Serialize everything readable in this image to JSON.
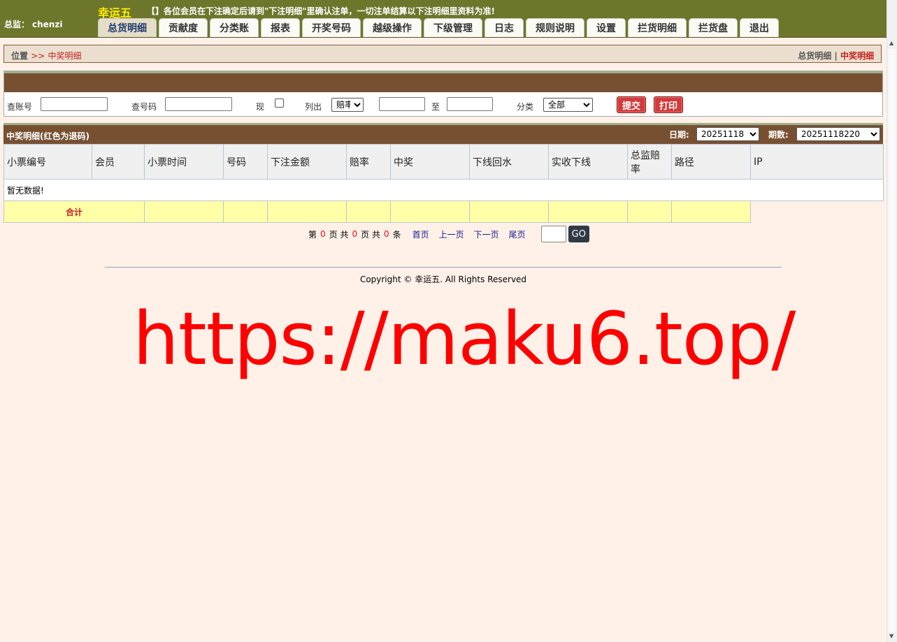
{
  "header": {
    "user_label": "总监：",
    "user_name": "chenzi",
    "brand": "幸运五",
    "notice": "【】各位会员在下注确定后请到\"下注明细\"里确认注单，一切注单结算以下注明细里资料为准!",
    "tabs": [
      {
        "label": "总货明细",
        "active": true
      },
      {
        "label": "贡献度"
      },
      {
        "label": "分类账"
      },
      {
        "label": "报表"
      },
      {
        "label": "开奖号码"
      },
      {
        "label": "越级操作"
      },
      {
        "label": "下级管理"
      },
      {
        "label": "日志"
      },
      {
        "label": "规则说明"
      },
      {
        "label": "设置"
      },
      {
        "label": "拦货明细"
      },
      {
        "label": "拦货盘"
      },
      {
        "label": "退出"
      }
    ]
  },
  "breadcrumb": {
    "prefix": "位置",
    "sep": ">>",
    "current": "中奖明细",
    "right_link": "总货明细",
    "right_sep": "|",
    "right_current": "中奖明细"
  },
  "filter": {
    "account_label": "查账号",
    "account_value": "",
    "number_label": "查号码",
    "number_value": "",
    "current_label": "现",
    "list_label": "列出",
    "list_selected": "赔率",
    "range_from": "",
    "range_to_label": "至",
    "range_to": "",
    "category_label": "分类",
    "category_selected": "全部",
    "submit_label": "提交",
    "print_label": "打印"
  },
  "results": {
    "title": "中奖明细(红色为退码)",
    "date_label": "日期:",
    "date_selected": "20251118",
    "period_label": "期数:",
    "period_selected": "20251118220",
    "columns": [
      "小票编号",
      "会员",
      "小票时间",
      "号码",
      "下注金额",
      "赔率",
      "中奖",
      "下线回水",
      "实收下线",
      "总监赔率",
      "路径",
      "IP"
    ],
    "empty_text": "暂无数据!",
    "total_label": "合计"
  },
  "pager": {
    "page_prefix": "第",
    "page_current": "0",
    "page_mid1": "页 共",
    "page_total": "0",
    "page_mid2": "页 共",
    "record_total": "0",
    "record_suffix": "条",
    "first": "首页",
    "prev": "上一页",
    "next": "下一页",
    "last": "尾页",
    "go": "GO"
  },
  "footer": {
    "copyright": "Copyright © 幸运五. All Rights Reserved"
  },
  "watermark": "https://maku6.top/",
  "colors": {
    "header_bg": "#6d762b",
    "panel_head": "#775032",
    "page_bg": "#fff1e8",
    "accent_red": "#c41e1e",
    "total_row": "#ffffa8"
  }
}
